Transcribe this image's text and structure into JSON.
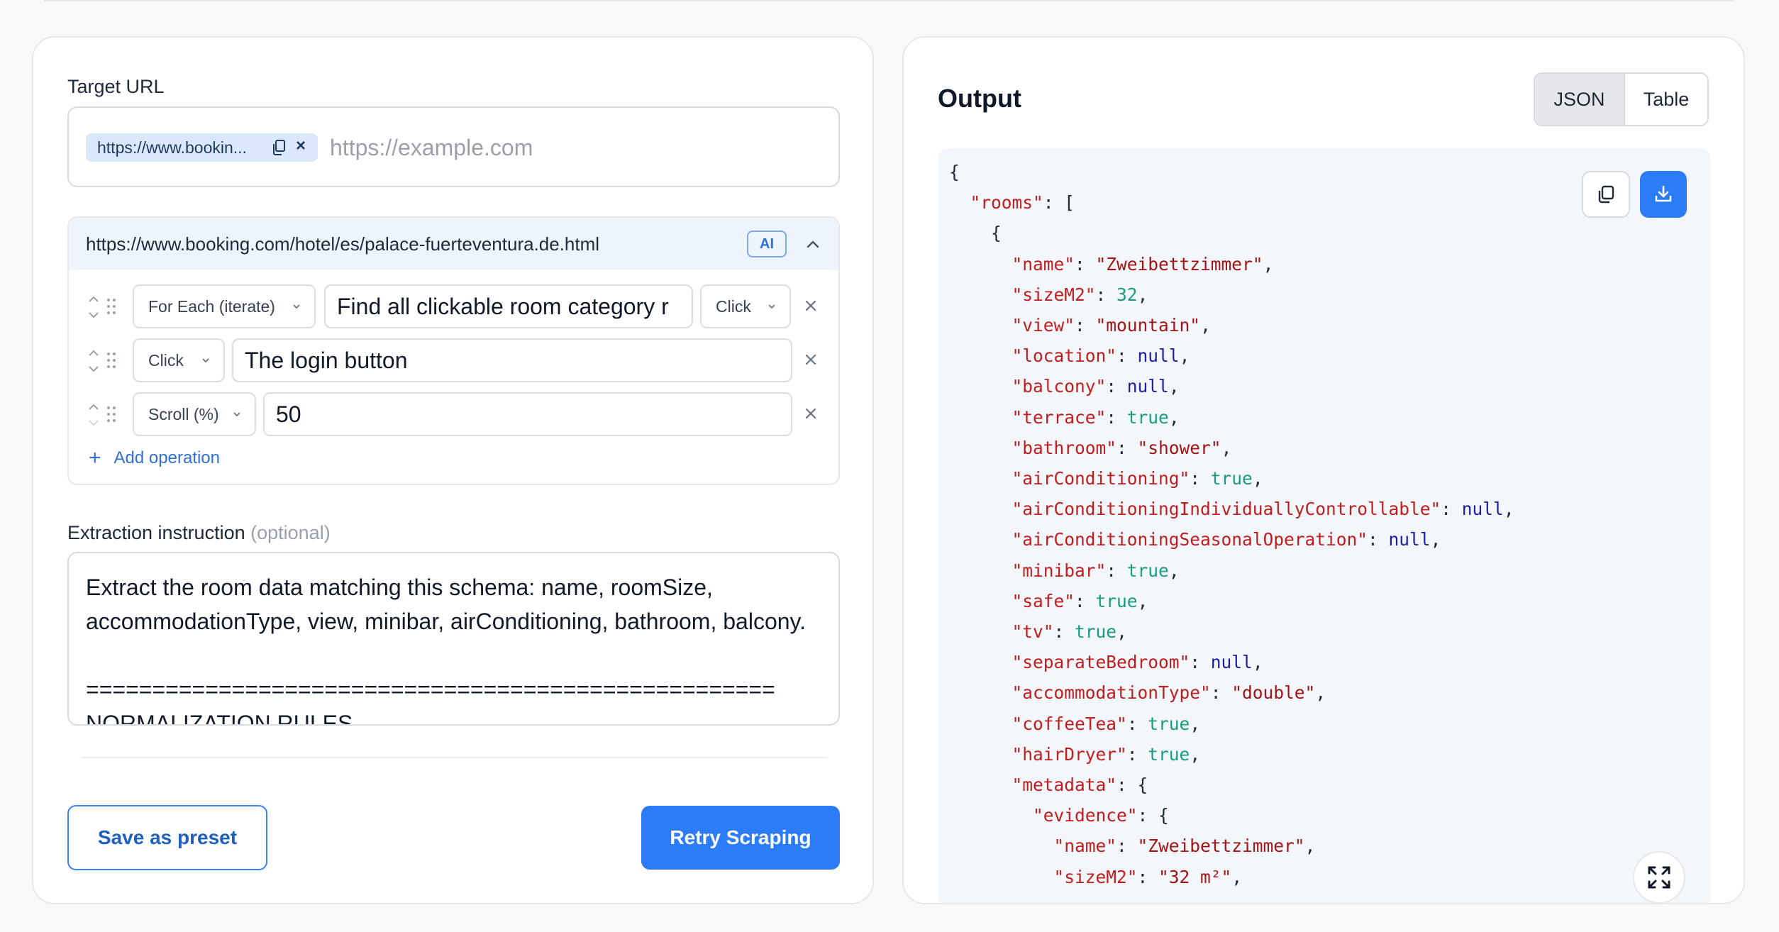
{
  "left": {
    "target_url_label": "Target URL",
    "url_chip": "https://www.booking.com/hotel/es/palace-fuerteventura.de.html",
    "url_chip_display": "https://www.bookin...",
    "url_placeholder": "https://example.com",
    "operations": {
      "url": "https://www.booking.com/hotel/es/palace-fuerteventura.de.html",
      "ai_badge": "AI",
      "rows": [
        {
          "type": "For Each (iterate)",
          "value": "Find all clickable room category r",
          "action": "Click"
        },
        {
          "type": "Click",
          "value": "The login button"
        },
        {
          "type": "Scroll (%)",
          "value": "50"
        }
      ],
      "add_label": "Add operation"
    },
    "extraction_label": "Extraction instruction",
    "extraction_optional": "(optional)",
    "extraction_text_1": "Extract the room data matching this schema: name, roomSize, accommodationType, view, minibar, airConditioning, bathroom, balcony.",
    "extraction_text_2": "====================================================",
    "extraction_text_3": "NORMALIZATION RULES",
    "save_preset": "Save as preset",
    "retry": "Retry Scraping"
  },
  "right": {
    "title": "Output",
    "toggle_json": "JSON",
    "toggle_table": "Table",
    "json_output": {
      "rooms_key": "rooms",
      "fields": [
        {
          "key": "name",
          "value": "\"Zweibettzimmer\"",
          "kind": "s"
        },
        {
          "key": "sizeM2",
          "value": "32",
          "kind": "n"
        },
        {
          "key": "view",
          "value": "\"mountain\"",
          "kind": "s"
        },
        {
          "key": "location",
          "value": "null",
          "kind": "nl"
        },
        {
          "key": "balcony",
          "value": "null",
          "kind": "nl"
        },
        {
          "key": "terrace",
          "value": "true",
          "kind": "b"
        },
        {
          "key": "bathroom",
          "value": "\"shower\"",
          "kind": "s"
        },
        {
          "key": "airConditioning",
          "value": "true",
          "kind": "b"
        },
        {
          "key": "airConditioningIndividuallyControllable",
          "value": "null",
          "kind": "nl"
        },
        {
          "key": "airConditioningSeasonalOperation",
          "value": "null",
          "kind": "nl"
        },
        {
          "key": "minibar",
          "value": "true",
          "kind": "b"
        },
        {
          "key": "safe",
          "value": "true",
          "kind": "b"
        },
        {
          "key": "tv",
          "value": "true",
          "kind": "b"
        },
        {
          "key": "separateBedroom",
          "value": "null",
          "kind": "nl"
        },
        {
          "key": "accommodationType",
          "value": "\"double\"",
          "kind": "s"
        },
        {
          "key": "coffeeTea",
          "value": "true",
          "kind": "b"
        },
        {
          "key": "hairDryer",
          "value": "true",
          "kind": "b"
        }
      ],
      "metadata_key": "metadata",
      "evidence_key": "evidence",
      "evidence_fields": [
        {
          "key": "name",
          "value": "\"Zweibettzimmer\"",
          "kind": "s"
        },
        {
          "key": "sizeM2",
          "value": "\"32 m²\"",
          "kind": "s"
        }
      ]
    }
  }
}
